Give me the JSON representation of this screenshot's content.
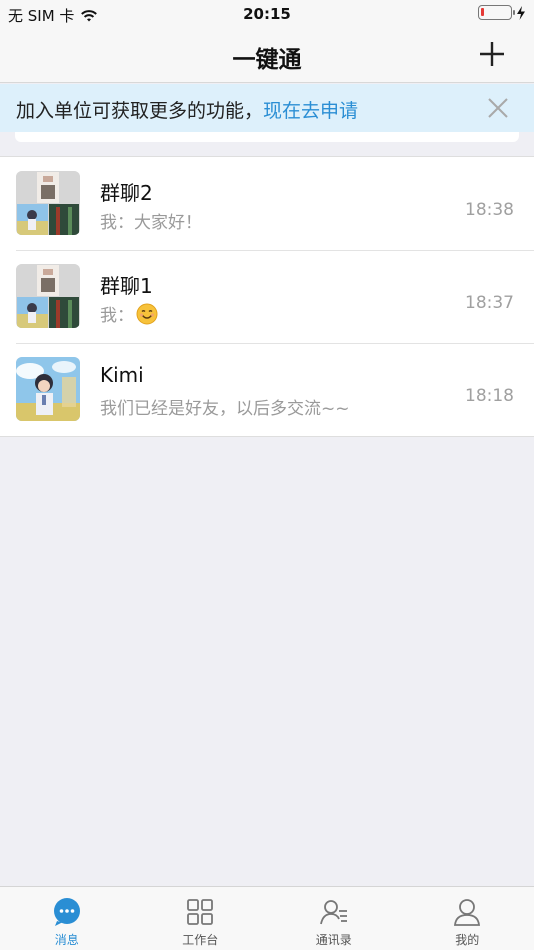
{
  "status_bar": {
    "carrier": "无 SIM 卡",
    "time": "20:15",
    "battery_level": 0.1
  },
  "nav": {
    "title": "一键通",
    "add_icon": "plus-icon"
  },
  "banner": {
    "text": "加入单位可获取更多的功能，",
    "link": "现在去申请",
    "close_icon": "close-icon"
  },
  "chats": [
    {
      "name": "群聊2",
      "preview": "我：大家好！",
      "time": "18:38",
      "avatar": "group-avatar"
    },
    {
      "name": "群聊1",
      "preview": "我：",
      "emoji": "😊",
      "time": "18:37",
      "avatar": "group-avatar"
    },
    {
      "name": "Kimi",
      "preview": "我们已经是好友，以后多交流~~",
      "time": "18:18",
      "avatar": "user-avatar"
    }
  ],
  "tabs": [
    {
      "label": "消息",
      "icon": "message-icon",
      "active": true
    },
    {
      "label": "工作台",
      "icon": "grid-icon",
      "active": false
    },
    {
      "label": "通讯录",
      "icon": "contacts-icon",
      "active": false
    },
    {
      "label": "我的",
      "icon": "profile-icon",
      "active": false
    }
  ],
  "colors": {
    "accent": "#2a8ed4",
    "banner_bg": "#ddf0fb",
    "background": "#efeff4"
  }
}
